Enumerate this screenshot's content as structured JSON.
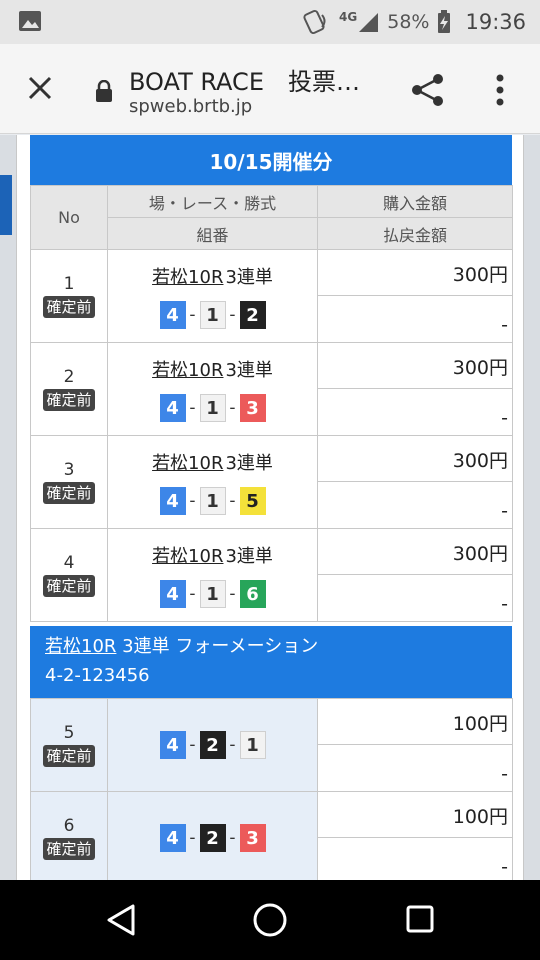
{
  "status": {
    "network": "4G",
    "battery": "58%",
    "time": "19:36"
  },
  "browser": {
    "title": "BOAT RACE　投票…",
    "url": "spweb.brtb.jp"
  },
  "date_header": "10/15開催分",
  "columns": {
    "no": "No",
    "race_info": "場・レース・勝式",
    "combo": "組番",
    "purchase": "購入金額",
    "payout": "払戻金額"
  },
  "badge_label": "確定前",
  "bets": [
    {
      "no": "1",
      "race": "若松10R",
      "type": "3連単",
      "combo": [
        "4",
        "1",
        "2"
      ],
      "amount": "300円",
      "payout": "-"
    },
    {
      "no": "2",
      "race": "若松10R",
      "type": "3連単",
      "combo": [
        "4",
        "1",
        "3"
      ],
      "amount": "300円",
      "payout": "-"
    },
    {
      "no": "3",
      "race": "若松10R",
      "type": "3連単",
      "combo": [
        "4",
        "1",
        "5"
      ],
      "amount": "300円",
      "payout": "-"
    },
    {
      "no": "4",
      "race": "若松10R",
      "type": "3連単",
      "combo": [
        "4",
        "1",
        "6"
      ],
      "amount": "300円",
      "payout": "-"
    }
  ],
  "formation": {
    "race": "若松10R",
    "type": "3連単 フォーメーション",
    "code": "4-2-123456",
    "bets": [
      {
        "no": "5",
        "combo": [
          "4",
          "2",
          "1"
        ],
        "amount": "100円",
        "payout": "-"
      },
      {
        "no": "6",
        "combo": [
          "4",
          "2",
          "3"
        ],
        "amount": "100円",
        "payout": "-"
      }
    ]
  },
  "box_colors": {
    "1": "#f2f2f2",
    "2": "#222222",
    "3": "#ec5a5a",
    "4": "#3d86e8",
    "5": "#f4e13a",
    "6": "#27a55a"
  },
  "icons": {
    "close": "close-icon",
    "lock": "lock-icon",
    "share": "share-icon",
    "menu": "more-vert-icon"
  }
}
